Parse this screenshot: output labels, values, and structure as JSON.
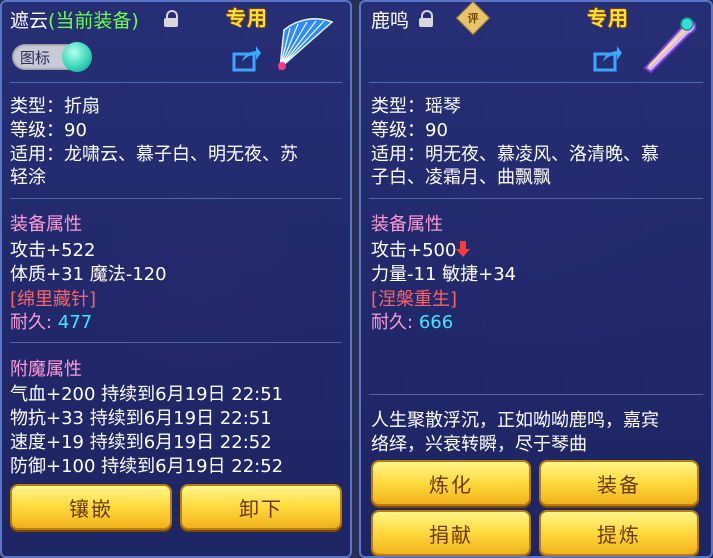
{
  "left": {
    "title_name": "遮云",
    "title_status": "(当前装备)",
    "tag": "专用",
    "icon_toggle_label": "图标",
    "type_line": "类型：折扇",
    "level_line": "等级：90",
    "suitable_line1": "适用：龙啸云、慕子白、明无夜、苏",
    "suitable_line2": "轻涂",
    "equip_attr_title": "装备属性",
    "attack": "攻击+522",
    "phys_magic": "体质+31 魔法-120",
    "special": "[绵里藏针]",
    "durability_label": "耐久:",
    "durability_value": "477",
    "enchant_title": "附魔属性",
    "enchant1": "气血+200 持续到6月19日 22:51",
    "enchant2": "物抗+33 持续到6月19日 22:51",
    "enchant3": "速度+19 持续到6月19日 22:52",
    "enchant4": "防御+100 持续到6月19日 22:52",
    "btn_inlay": "镶嵌",
    "btn_unequip": "卸下"
  },
  "right": {
    "title_name": "鹿鸣",
    "badge": "评",
    "tag": "专用",
    "type_line": "类型：瑶琴",
    "level_line": "等级：90",
    "suitable_line1": "适用：明无夜、慕凌风、洛清晚、慕",
    "suitable_line2": "子白、凌霜月、曲飘飘",
    "equip_attr_title": "装备属性",
    "attack": "攻击+500",
    "str_agi": "力量-11 敏捷+34",
    "special": "[涅槃重生]",
    "durability_label": "耐久:",
    "durability_value": "666",
    "desc_line1": "人生聚散浮沉，正如呦呦鹿鸣，嘉宾",
    "desc_line2": "络绎，兴衰转瞬，尽于琴曲",
    "btn_refine": "炼化",
    "btn_equip": "装备",
    "btn_donate": "捐献",
    "btn_extract": "提炼"
  },
  "colors": {
    "panel": "#262e78",
    "button": "#ffd93d",
    "tag": "#ffdf3a",
    "current_equipped": "#6bff4a",
    "section_title": "#ff9ad2",
    "special_red": "#ff6262",
    "durability_cyan": "#3fe8ff"
  }
}
